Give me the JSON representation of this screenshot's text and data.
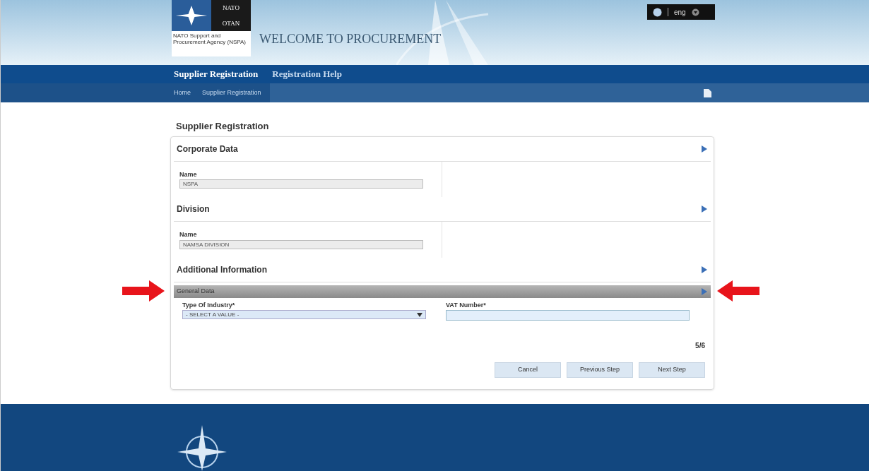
{
  "header": {
    "logo_lines": [
      "NATO",
      "OTAN"
    ],
    "agency": "NATO Support and Procurement Agency (NSPA)",
    "title": "WELCOME TO PROCUREMENT",
    "language": "eng"
  },
  "nav": {
    "items": [
      {
        "label": "Supplier Registration",
        "selected": true
      },
      {
        "label": "Registration Help",
        "selected": false
      }
    ],
    "breadcrumb": [
      "Home",
      "Supplier Registration"
    ]
  },
  "page_title": "Supplier Registration",
  "sections": [
    {
      "title": "Corporate Data",
      "field_label": "Name",
      "field_value": "NSPA"
    },
    {
      "title": "Division",
      "field_label": "Name",
      "field_value": "NAMSA DIVISION"
    }
  ],
  "additional": {
    "title": "Additional Information",
    "subsection": "General Data",
    "industry": {
      "label": "Type Of Industry*",
      "value": "- SELECT A VALUE -"
    },
    "vat": {
      "label": "VAT Number*"
    }
  },
  "step": "5/6",
  "buttons": [
    "Cancel",
    "Previous Step",
    "Next Step"
  ]
}
